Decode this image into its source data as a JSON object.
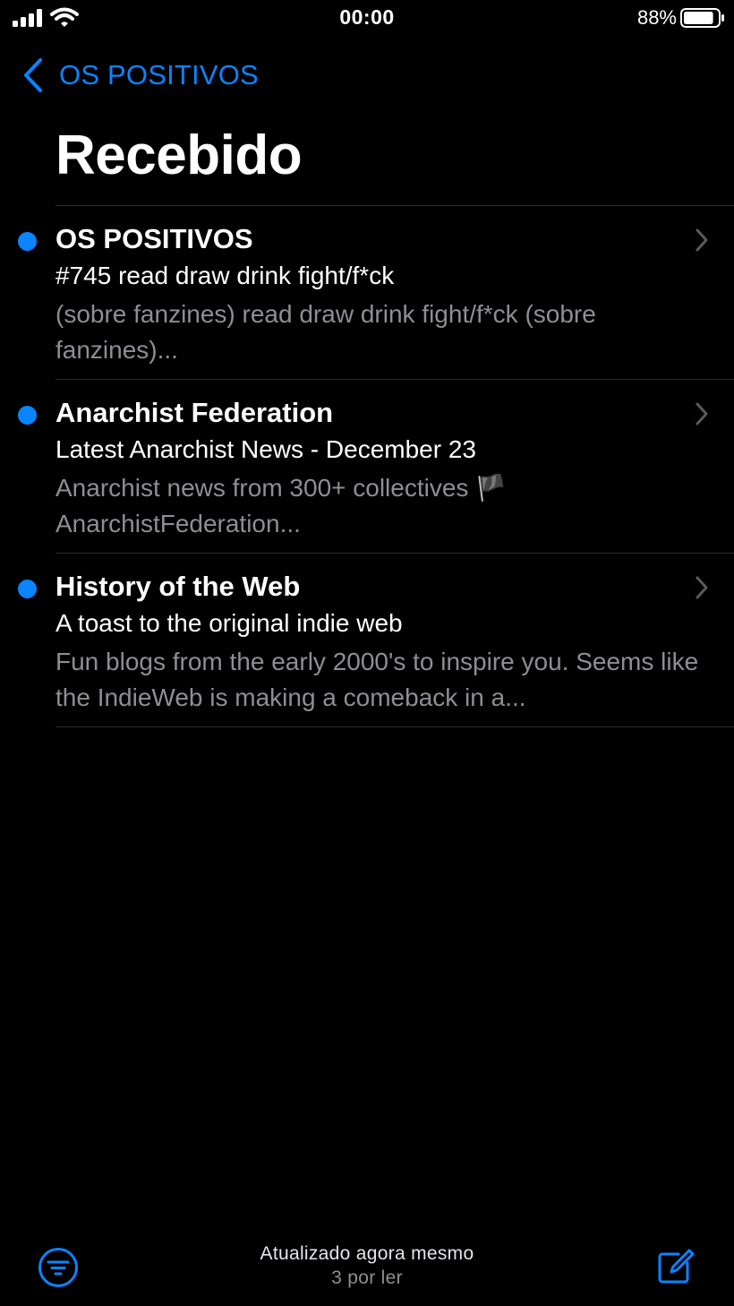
{
  "status_bar": {
    "time": "00:00",
    "battery_percent": "88%",
    "battery_level": 0.88,
    "icons": [
      "signal-icon",
      "wifi-icon",
      "battery-icon"
    ]
  },
  "nav": {
    "back_label": "OS POSITIVOS",
    "back_icon": "chevron-left-icon"
  },
  "title": "Recebido",
  "messages": [
    {
      "sender": "OS POSITIVOS",
      "subject": "#745 read draw drink fight/f*ck",
      "preview": "(sobre fanzines) read draw drink fight/f*ck (sobre fanzines)...",
      "unread": true
    },
    {
      "sender": "Anarchist Federation",
      "subject": "Latest Anarchist News - December 23",
      "preview": "Anarchist news from 300+ collectives 🏴 AnarchistFederation...",
      "unread": true
    },
    {
      "sender": "History of the Web",
      "subject": "A toast to the original indie web",
      "preview": "Fun blogs from the early 2000's to inspire you. Seems like the IndieWeb is making a comeback in a...",
      "unread": true
    }
  ],
  "toolbar": {
    "status": "Atualizado agora mesmo",
    "unread_count": "3 por ler",
    "filter_icon": "filter-icon",
    "compose_icon": "compose-icon"
  },
  "colors": {
    "accent": "#0a84ff",
    "background": "#000000",
    "secondary_text": "#8e8e93",
    "divider": "#2b2b2e"
  }
}
